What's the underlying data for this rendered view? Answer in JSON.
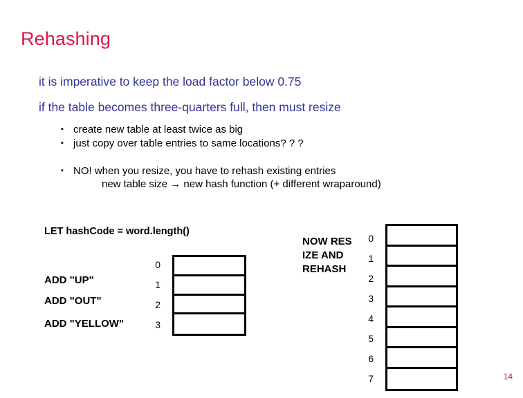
{
  "slide": {
    "title": "Rehashing",
    "page_number": "14",
    "title_color": "#D41B45",
    "body_color": "#333399",
    "bullet_color": "#000000",
    "page_number_color": "#9E2B4E"
  },
  "body": {
    "lines": [
      "it is imperative to keep the load factor below 0.75",
      "if the table becomes three-quarters full, then must resize"
    ]
  },
  "bullets": {
    "marker": "▪",
    "items": [
      "create new table at least twice as big",
      "just copy over table entries to same locations? ? ?",
      "NO! when you resize, you have to rehash existing entries"
    ],
    "continuation": "new table size → new hash function (+ different wraparound)"
  },
  "demo": {
    "hash_definition": "LET hashCode = word.length()",
    "operations": [
      "ADD \"UP\"",
      "ADD \"OUT\"",
      "ADD \"YELLOW\""
    ],
    "left_table": {
      "indices": [
        "0",
        "1",
        "2",
        "3"
      ],
      "cells": [
        "",
        "",
        "",
        ""
      ]
    },
    "resize_note": "NOW RESIZE AND REHASH",
    "right_table": {
      "indices": [
        "0",
        "1",
        "2",
        "3",
        "4",
        "5",
        "6",
        "7"
      ],
      "cells": [
        "",
        "",
        "",
        "",
        "",
        "",
        "",
        ""
      ]
    }
  }
}
